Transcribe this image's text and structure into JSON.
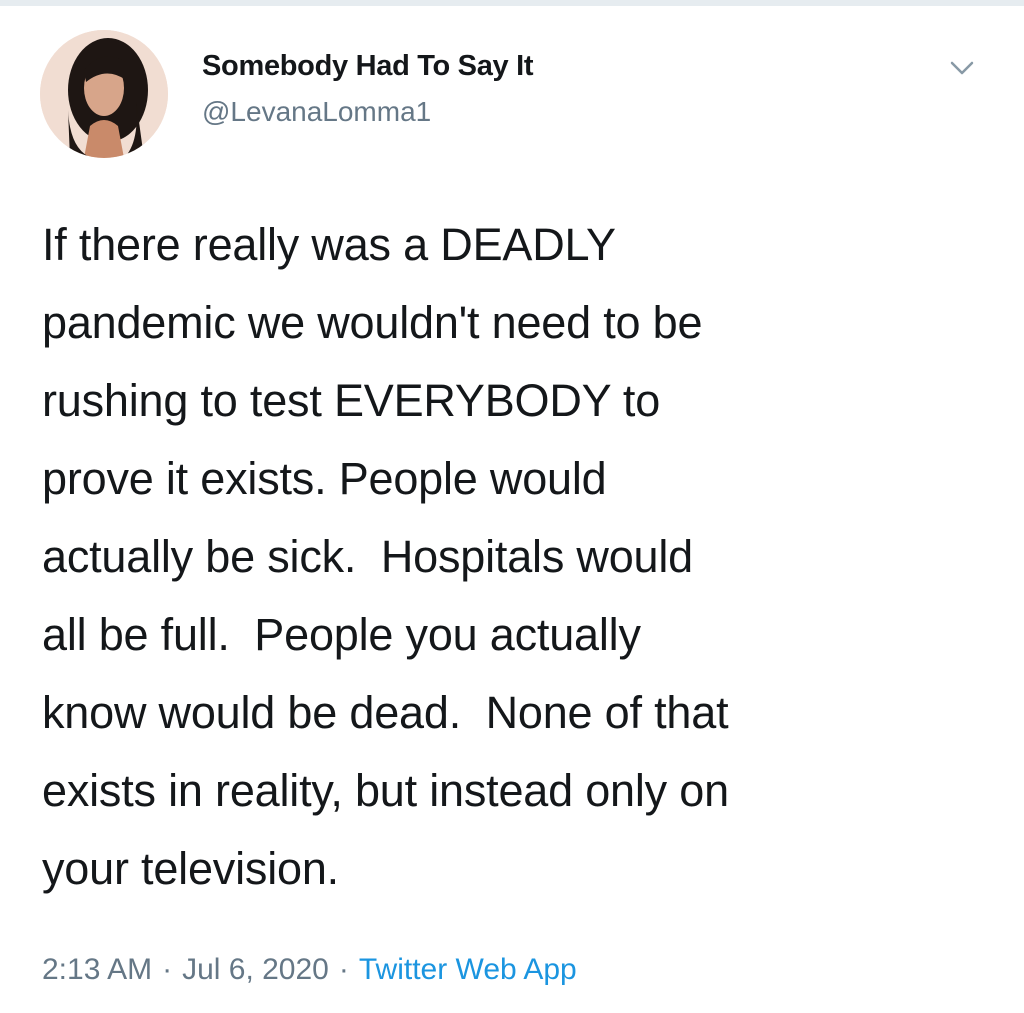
{
  "tweet": {
    "author": {
      "display_name": "Somebody Had To Say It",
      "handle": "@LevanaLomma1",
      "avatar_icon": "profile-photo"
    },
    "menu_icon": "chevron-down-icon",
    "text": "If there really was a DEADLY\npandemic we wouldn't need to be\nrushing to test EVERYBODY to\nprove it exists. People would\nactually be sick.  Hospitals would\nall be full.  People you actually\nknow would be dead.  None of that\nexists in reality, but instead only on\nyour television.",
    "time": "2:13 AM",
    "separator": "·",
    "date": "Jul 6, 2020",
    "source": "Twitter Web App"
  },
  "colors": {
    "text": "#14171a",
    "secondary": "#657786",
    "link": "#1b95e0",
    "border": "#e6ecf0"
  }
}
